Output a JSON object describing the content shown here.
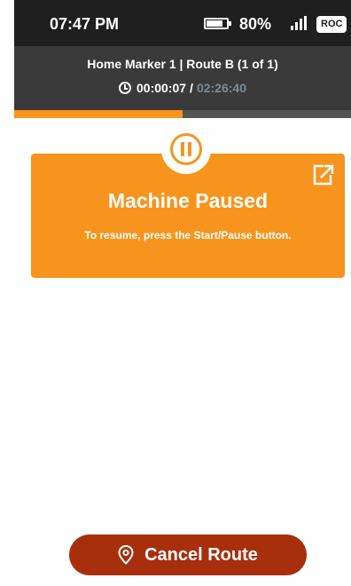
{
  "status_bar": {
    "time": "07:47 PM",
    "battery_percent": "80%",
    "battery_level": 0.8,
    "network_badge": "ROC"
  },
  "route": {
    "title": "Home Marker 1 | Route B (1 of 1)",
    "elapsed": "00:00:07",
    "separator": "/",
    "total": "02:26:40",
    "progress": 0.5
  },
  "alert": {
    "title": "Machine Paused",
    "message": "To resume, press the Start/Pause button."
  },
  "actions": {
    "cancel_label": "Cancel Route"
  },
  "colors": {
    "accent": "#f7941d",
    "danger": "#a82f0c",
    "status_bar": "#1f1f1f",
    "header": "#3a3a3a"
  },
  "icons": [
    "battery-icon",
    "signal-icon",
    "clock-icon",
    "pause-icon",
    "expand-icon",
    "location-pin-icon"
  ]
}
